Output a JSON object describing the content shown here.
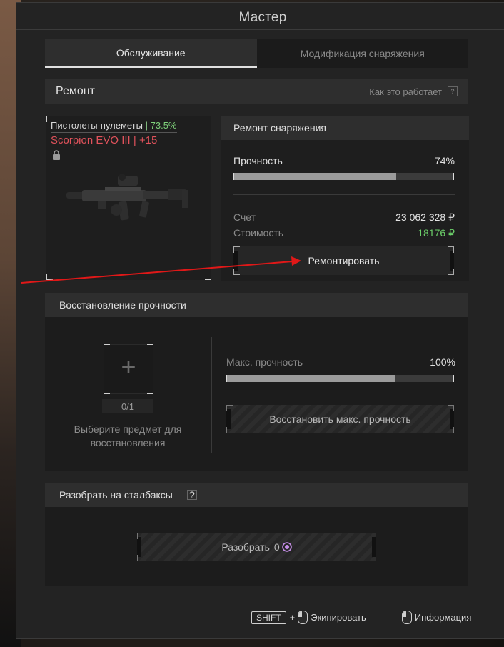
{
  "window": {
    "title": "Мастер"
  },
  "tabs": [
    {
      "label": "Обслуживание",
      "active": true
    },
    {
      "label": "Модификация снаряжения",
      "active": false
    }
  ],
  "repair": {
    "title": "Ремонт",
    "how_it_works": "Как это работает",
    "help_icon": "question-icon"
  },
  "item": {
    "category": "Пистолеты-пулеметы",
    "category_sep": "|",
    "category_percent": "73.5%",
    "name": "Scorpion EVO III | +15",
    "name_color": "#e0525b",
    "locked": true
  },
  "equipment_repair": {
    "title": "Ремонт снаряжения",
    "durability_label": "Прочность",
    "durability_value": "74%",
    "durability_fraction": 0.74,
    "account_label": "Счет",
    "account_value": "23 062 328 ₽",
    "cost_label": "Стоимость",
    "cost_value": "18176 ₽",
    "cost_color": "#6ccf6a",
    "repair_button": "Ремонтировать"
  },
  "restore": {
    "title": "Восстановление прочности",
    "slot_count": "0/1",
    "hint": "Выберите предмет для восстановления",
    "max_durability_label": "Макс. прочность",
    "max_durability_value": "100%",
    "max_durability_fraction": 0.74,
    "restore_button": "Восстановить макс. прочность"
  },
  "disassemble": {
    "title": "Разобрать на сталбаксы",
    "button_label": "Разобрать",
    "button_value": "0",
    "currency_icon": "stalbucks-icon"
  },
  "footer": {
    "shift_key": "SHIFT",
    "plus": "+",
    "equip_label": "Экипировать",
    "info_label": "Информация"
  }
}
